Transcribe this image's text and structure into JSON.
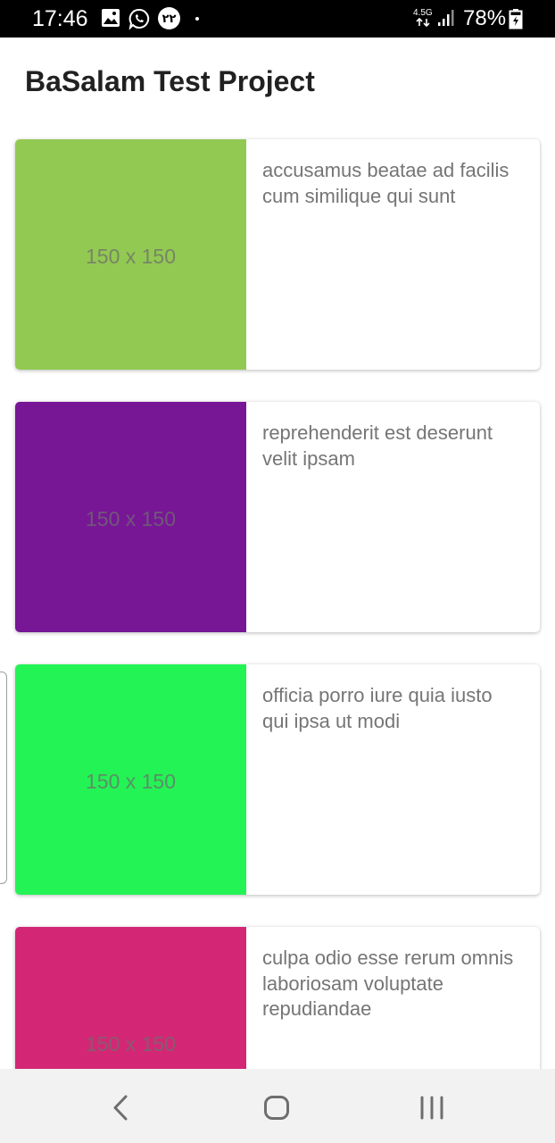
{
  "status_bar": {
    "time": "17:46",
    "notification_badge": "۲۲",
    "network_type": "4.5G",
    "battery_percent": "78%",
    "icons": [
      "gallery-icon",
      "whatsapp-icon",
      "notification-badge-icon",
      "network-arrows-icon",
      "signal-icon",
      "battery-charging-icon"
    ]
  },
  "app_bar": {
    "title": "BaSalam Test Project"
  },
  "items": [
    {
      "thumb_label": "150 x 150",
      "thumb_color": "#92c952",
      "title": "accusamus beatae ad facilis cum similique qui sunt"
    },
    {
      "thumb_label": "150 x 150",
      "thumb_color": "#771796",
      "title": "reprehenderit est deserunt velit ipsam"
    },
    {
      "thumb_label": "150 x 150",
      "thumb_color": "#24f355",
      "title": "officia porro iure quia iusto qui ipsa ut modi"
    },
    {
      "thumb_label": "150 x 150",
      "thumb_color": "#d32776",
      "title": "culpa odio esse rerum omnis laboriosam voluptate repudiandae"
    }
  ],
  "nav_bar": {
    "buttons": [
      "back-icon",
      "home-icon",
      "recents-icon"
    ]
  }
}
